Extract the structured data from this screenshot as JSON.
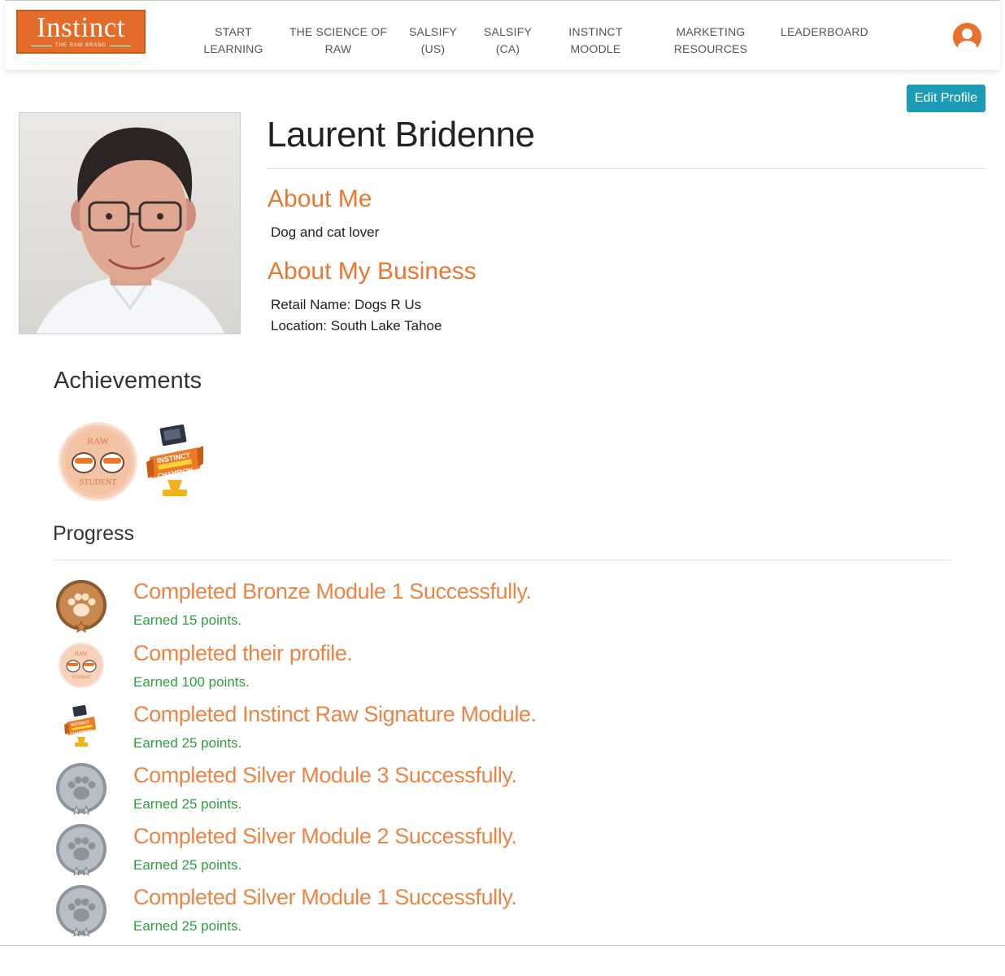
{
  "navbar": {
    "logo_text": "Instinct",
    "logo_sub": "THE RAW BRAND",
    "items": [
      {
        "line1": "START",
        "line2": "LEARNING"
      },
      {
        "line1": "THE SCIENCE OF",
        "line2": "RAW"
      },
      {
        "line1": "SALSIFY",
        "line2": "(US)"
      },
      {
        "line1": "SALSIFY",
        "line2": "(CA)"
      },
      {
        "line1": "INSTINCT",
        "line2": "MOODLE"
      },
      {
        "line1": "MARKETING",
        "line2": "RESOURCES"
      },
      {
        "line1": "LEADERBOARD",
        "line2": ""
      }
    ]
  },
  "profile": {
    "edit_label": "Edit Profile",
    "name": "Laurent Bridenne",
    "about_me_heading": "About Me",
    "about_me_text": "Dog and cat lover",
    "business_heading": "About My Business",
    "retail_name": "Retail Name: Dogs R Us",
    "location": "Location: South Lake Tahoe"
  },
  "achievements": {
    "title": "Achievements",
    "badges": [
      {
        "icon": "raw-student-badge-icon",
        "top_text": "RAW",
        "bottom_text": "STUDENT"
      },
      {
        "icon": "instinct-champion-badge-icon",
        "line1": "INSTINCT",
        "line2": "SIGNATURE",
        "line3": "CHAMPION"
      }
    ]
  },
  "progress": {
    "title": "Progress",
    "items": [
      {
        "icon": "bronze-paw-medal-icon",
        "title": "Completed Bronze Module 1 Successfully.",
        "points": "Earned 15 points."
      },
      {
        "icon": "raw-student-badge-icon",
        "title": "Completed their profile.",
        "points": "Earned 100 points."
      },
      {
        "icon": "instinct-champion-badge-icon",
        "title": "Completed Instinct Raw Signature Module.",
        "points": "Earned 25 points."
      },
      {
        "icon": "silver-paw-medal-icon",
        "title": "Completed Silver Module 3 Successfully.",
        "points": "Earned 25 points."
      },
      {
        "icon": "silver-paw-medal-icon",
        "title": "Completed Silver Module 2 Successfully.",
        "points": "Earned 25 points."
      },
      {
        "icon": "silver-paw-medal-icon",
        "title": "Completed Silver Module 1 Successfully.",
        "points": "Earned 25 points."
      }
    ]
  },
  "colors": {
    "brand_orange": "#e56b29",
    "heading_orange": "#e87830",
    "points_green": "#2f9e3f",
    "button_teal": "#1b9bb5"
  }
}
